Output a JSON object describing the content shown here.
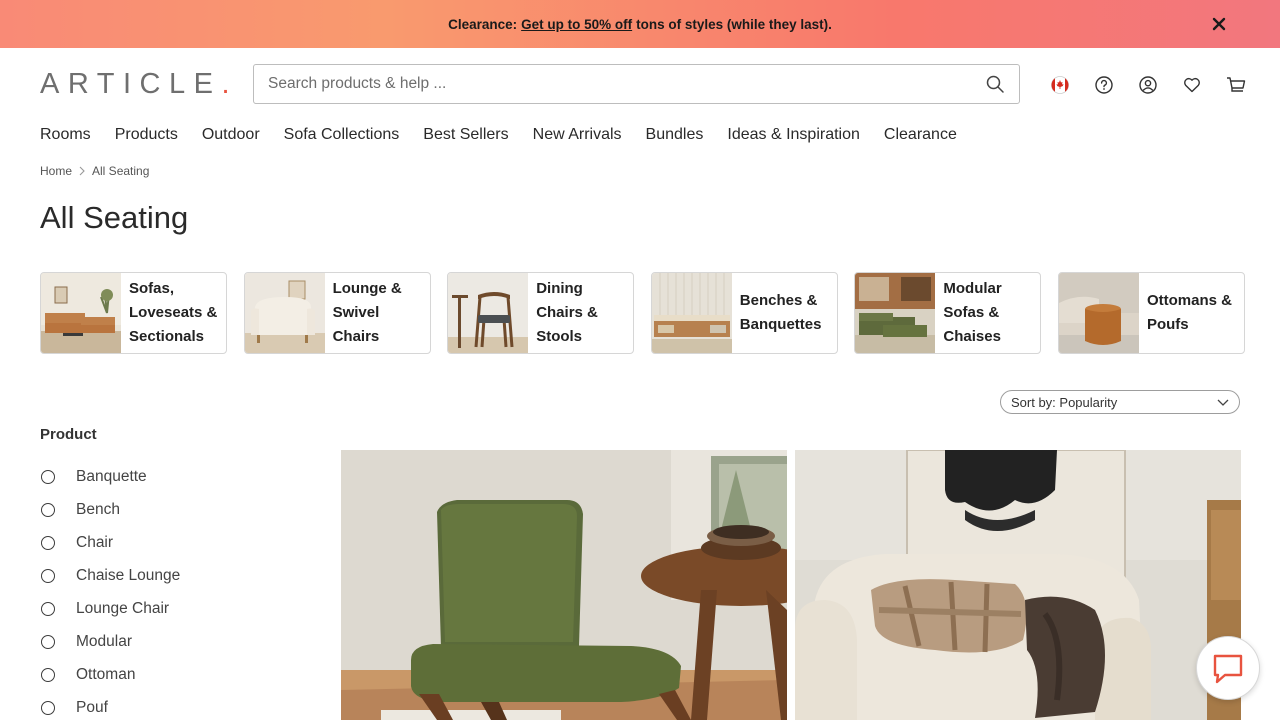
{
  "banner": {
    "prefix": "Clearance:",
    "link": "Get up to 50% off",
    "suffix": "tons of styles (while they last)."
  },
  "header": {
    "logo": "ARTICLE",
    "logo_dot": ".",
    "search_placeholder": "Search products & help ..."
  },
  "nav": [
    "Rooms",
    "Products",
    "Outdoor",
    "Sofa Collections",
    "Best Sellers",
    "New Arrivals",
    "Bundles",
    "Ideas & Inspiration",
    "Clearance"
  ],
  "breadcrumb": [
    "Home",
    "All Seating"
  ],
  "page_title": "All Seating",
  "categories": [
    {
      "label": "Sofas, Loveseats & Sectionals"
    },
    {
      "label": "Lounge & Swivel Chairs"
    },
    {
      "label": "Dining Chairs & Stools"
    },
    {
      "label": "Benches & Banquettes"
    },
    {
      "label": "Modular Sofas & Chaises"
    },
    {
      "label": "Ottomans & Poufs"
    }
  ],
  "sort": {
    "label": "Sort by: Popularity"
  },
  "filters": {
    "title": "Product",
    "options": [
      "Banquette",
      "Bench",
      "Chair",
      "Chaise Lounge",
      "Lounge Chair",
      "Modular",
      "Ottoman",
      "Pouf"
    ]
  },
  "colors": {
    "banner_start": "#f98a76",
    "banner_end": "#f2777e",
    "logo_dot": "#e8533f"
  }
}
